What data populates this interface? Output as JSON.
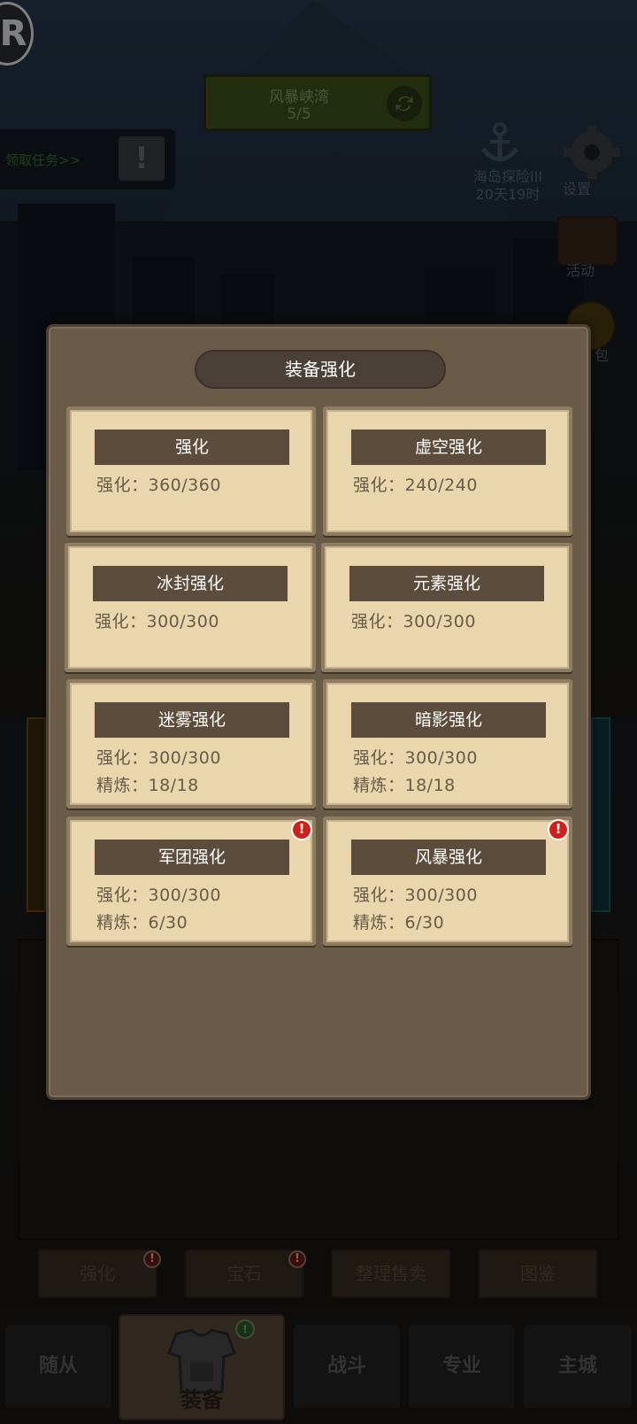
{
  "top": {
    "logo_letter": "R",
    "stage": {
      "name": "风暴峡湾",
      "progress": "5/5"
    },
    "quest_link": "领取任务>>",
    "quest_alert": "!",
    "event": {
      "name": "海岛探险III",
      "time_left": "20天19时"
    },
    "settings_label": "设置",
    "activity_label": "活动",
    "bag_label": "包"
  },
  "modal": {
    "title": "装备强化",
    "cards": [
      {
        "title": "强化",
        "line1": "强化：360/360",
        "line2": "",
        "alert": false
      },
      {
        "title": "虚空强化",
        "line1": "强化：240/240",
        "line2": "",
        "alert": false
      },
      {
        "title": "冰封强化",
        "line1": "强化：300/300",
        "line2": "",
        "alert": false
      },
      {
        "title": "元素强化",
        "line1": "强化：300/300",
        "line2": "",
        "alert": false
      },
      {
        "title": "迷雾强化",
        "line1": "强化：300/300",
        "line2": "精炼：18/18",
        "alert": false
      },
      {
        "title": "暗影强化",
        "line1": "强化：300/300",
        "line2": "精炼：18/18",
        "alert": false
      },
      {
        "title": "军团强化",
        "line1": "强化：300/300",
        "line2": "精炼：6/30",
        "alert": true
      },
      {
        "title": "风暴强化",
        "line1": "强化：300/300",
        "line2": "精炼：6/30",
        "alert": true
      }
    ],
    "alert_mark": "!"
  },
  "sub_tabs": [
    {
      "label": "强化",
      "badge": "!"
    },
    {
      "label": "宝石",
      "badge": "!"
    },
    {
      "label": "整理售卖",
      "badge": ""
    },
    {
      "label": "图鉴",
      "badge": ""
    }
  ],
  "nav": {
    "items": [
      "随从",
      "装备",
      "战斗",
      "专业",
      "主城"
    ],
    "active": "装备",
    "active_badge": "!"
  }
}
